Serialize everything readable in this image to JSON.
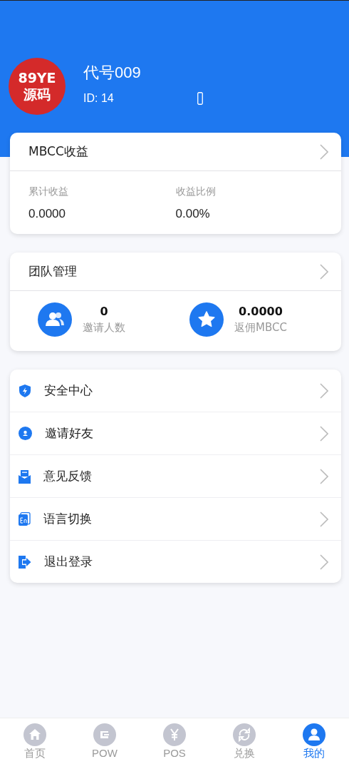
{
  "profile": {
    "avatar_text": [
      "89YE",
      "源码"
    ],
    "name": "代号009",
    "id": "ID: 14"
  },
  "earnings": {
    "title": "MBCC收益",
    "stats": [
      {
        "label": "累计收益",
        "value": "0.0000"
      },
      {
        "label": "收益比例",
        "value": "0.00%"
      }
    ]
  },
  "team": {
    "title": "团队管理",
    "stats": [
      {
        "kind": "people",
        "value": "0",
        "label": "邀请人数"
      },
      {
        "kind": "star",
        "value": "0.0000",
        "label": "返佣MBCC"
      }
    ]
  },
  "menu": [
    {
      "kind": "shield",
      "label": "安全中心"
    },
    {
      "kind": "user",
      "label": "邀请好友"
    },
    {
      "kind": "mail",
      "label": "意见反馈"
    },
    {
      "kind": "lang",
      "label": "语言切换"
    },
    {
      "kind": "logout",
      "label": "退出登录"
    }
  ],
  "tabbar": [
    {
      "kind": "home",
      "label": "首页",
      "selected": false
    },
    {
      "kind": "wallet",
      "label": "POW",
      "selected": false
    },
    {
      "kind": "yen",
      "label": "POS",
      "selected": false
    },
    {
      "kind": "swap",
      "label": "兑换",
      "selected": false
    },
    {
      "kind": "me",
      "label": "我的",
      "selected": true
    }
  ]
}
